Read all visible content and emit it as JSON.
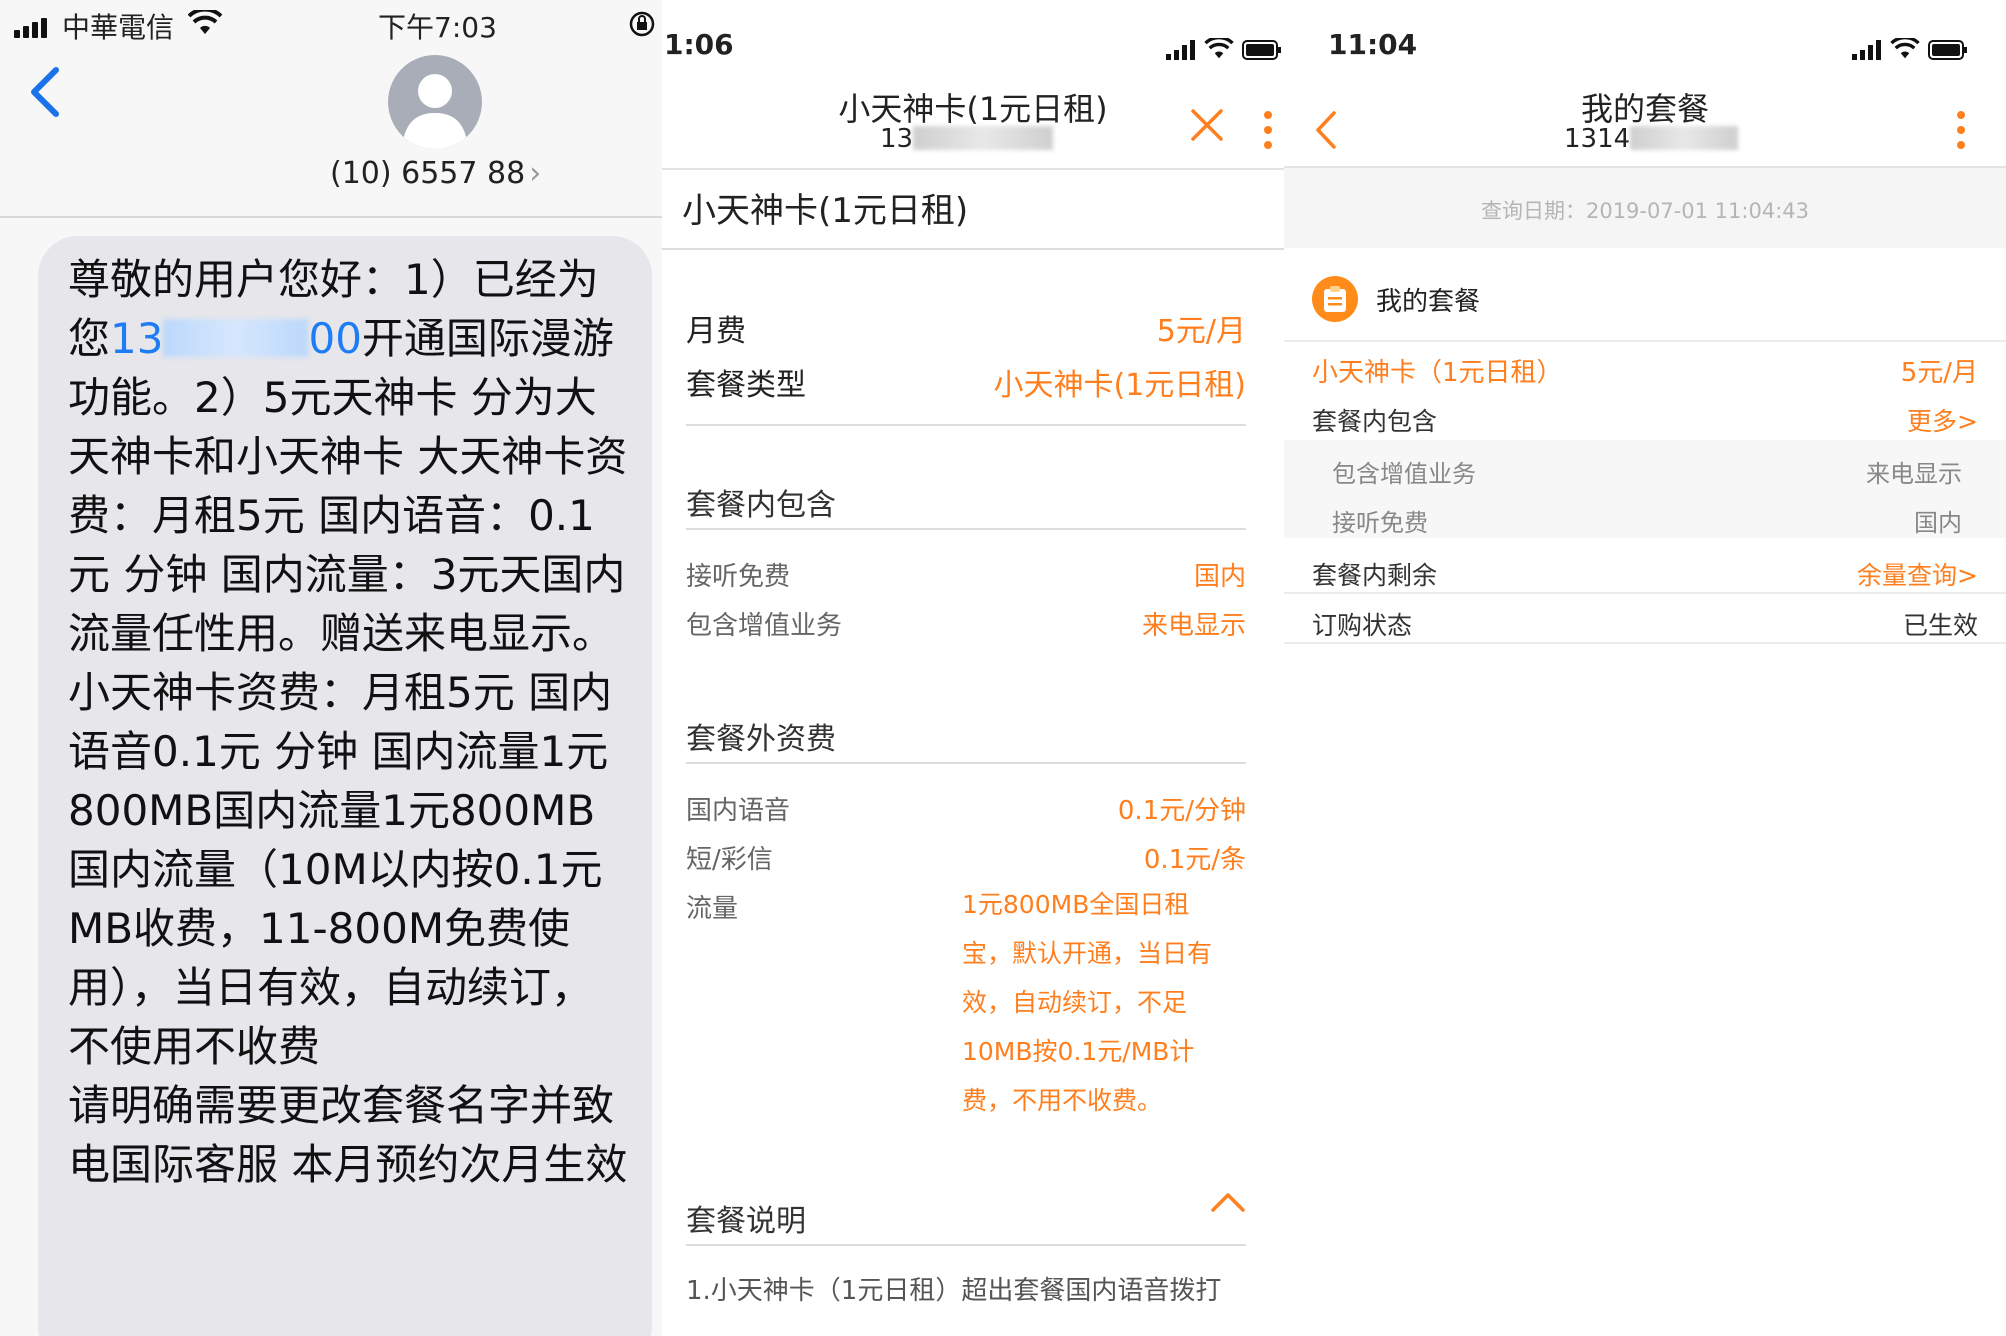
{
  "sms": {
    "status": {
      "carrier": "中華電信",
      "time": "下午7:03"
    },
    "contact": {
      "number": "(10) 6557 88",
      "chevron": "›"
    },
    "message": {
      "p1_a": "尊敬的用户您好：1）已经为您",
      "link_start": "13",
      "link_end": "00",
      "p1_b": "开通国际漫游功能。2）5元天神卡 分为大天神卡和小天神卡 大天神卡资费：月租5元  国内语音：0.1元 分钟  国内流量：3元天国内流量任性用。赠送来电显示。 小天神卡资费：月租5元 国内语音0.1元 分钟 国内流量1元800MB国内流量1元800MB国内流量（10M以内按0.1元 MB收费，11-800M免费使用），当日有效，自动续订，不使用不收费",
      "p2": "请明确需要更改套餐名字并致电国际客服 本月预约次月生效"
    }
  },
  "detail": {
    "status": {
      "time": "1:06"
    },
    "nav": {
      "title": "小天神卡(1元日租)",
      "number": "13"
    },
    "heading": "小天神卡(1元日租)",
    "basic": [
      {
        "label": "月费",
        "value": "5元/月"
      },
      {
        "label": "套餐类型",
        "value": "小天神卡(1元日租)"
      }
    ],
    "included": {
      "title": "套餐内包含",
      "rows": [
        {
          "label": "接听免费",
          "value": "国内"
        },
        {
          "label": "包含增值业务",
          "value": "来电显示"
        }
      ]
    },
    "extra": {
      "title": "套餐外资费",
      "rows": [
        {
          "label": "国内语音",
          "value": "0.1元/分钟"
        },
        {
          "label": "短/彩信",
          "value": "0.1元/条"
        }
      ],
      "flow_label": "流量",
      "flow_value": "1元800MB全国日租宝，默认开通，当日有效，自动续订，不足10MB按0.1元/MB计费，不用不收费。"
    },
    "desc": {
      "title": "套餐说明",
      "text": "1.小天神卡（1元日租）超出套餐国内语音拨打"
    }
  },
  "mine": {
    "status": {
      "time": "11:04"
    },
    "nav": {
      "title": "我的套餐",
      "number": "1314"
    },
    "query_date": "查询日期：2019-07-01 11:04:43",
    "section_title": "我的套餐",
    "package": {
      "name": "小天神卡（1元日租）",
      "price": "5元/月"
    },
    "included": {
      "label": "套餐内包含",
      "link": "更多>"
    },
    "included_items": [
      {
        "label": "包含增值业务",
        "value": "来电显示"
      },
      {
        "label": "接听免费",
        "value": "国内"
      }
    ],
    "remaining": {
      "label": "套餐内剩余",
      "link": "余量查询>"
    },
    "order_status": {
      "label": "订购状态",
      "value": "已生效"
    }
  },
  "colors": {
    "accent": "#ff7f1e",
    "link": "#1e7df5",
    "ios_blue": "#1a73e8"
  }
}
